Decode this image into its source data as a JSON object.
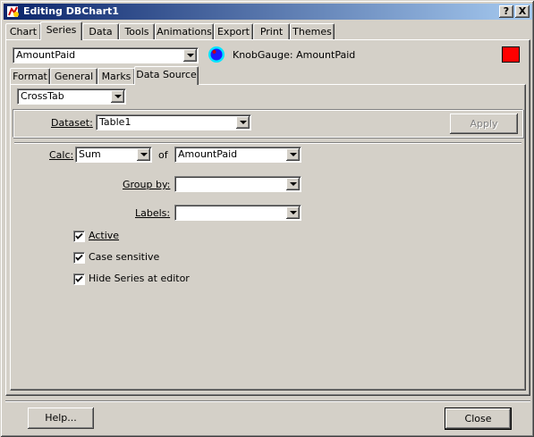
{
  "window": {
    "title": "Editing DBChart1",
    "help_caption": "?",
    "close_caption": "X"
  },
  "main_tabs": [
    "Chart",
    "Series",
    "Data",
    "Tools",
    "Animations",
    "Export",
    "Print",
    "Themes"
  ],
  "series": {
    "selected": "AmountPaid",
    "description": "KnobGauge: AmountPaid",
    "color": "#ff0000"
  },
  "series_tabs": [
    "Format",
    "General",
    "Marks",
    "Data Source"
  ],
  "datasource": {
    "mode": "CrossTab",
    "dataset_label": "Dataset:",
    "dataset_value": "Table1",
    "apply_label": "Apply",
    "calc_label": "Calc:",
    "calc_value": "Sum",
    "of_label": "of",
    "of_value": "AmountPaid",
    "groupby_label": "Group by:",
    "groupby_value": "",
    "labels_label": "Labels:",
    "labels_value": "",
    "active_label": "Active",
    "case_label": "Case sensitive",
    "hide_label": "Hide Series at editor"
  },
  "footer": {
    "help_label": "Help...",
    "close_label": "Close"
  },
  "colors": {
    "title_start": "#0a246a",
    "title_end": "#a6caf0",
    "face": "#d4d0c8"
  }
}
